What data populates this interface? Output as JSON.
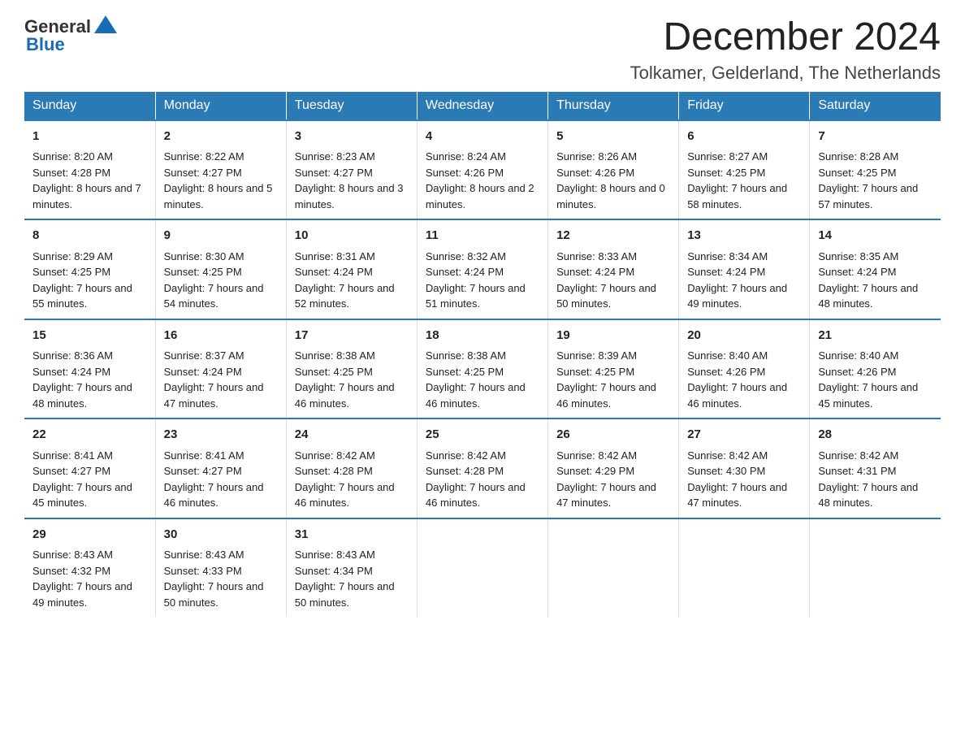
{
  "header": {
    "logo_general": "General",
    "logo_blue": "Blue",
    "month_title": "December 2024",
    "location": "Tolkamer, Gelderland, The Netherlands"
  },
  "days_of_week": [
    "Sunday",
    "Monday",
    "Tuesday",
    "Wednesday",
    "Thursday",
    "Friday",
    "Saturday"
  ],
  "weeks": [
    [
      {
        "num": "1",
        "sunrise": "8:20 AM",
        "sunset": "4:28 PM",
        "daylight": "8 hours and 7 minutes."
      },
      {
        "num": "2",
        "sunrise": "8:22 AM",
        "sunset": "4:27 PM",
        "daylight": "8 hours and 5 minutes."
      },
      {
        "num": "3",
        "sunrise": "8:23 AM",
        "sunset": "4:27 PM",
        "daylight": "8 hours and 3 minutes."
      },
      {
        "num": "4",
        "sunrise": "8:24 AM",
        "sunset": "4:26 PM",
        "daylight": "8 hours and 2 minutes."
      },
      {
        "num": "5",
        "sunrise": "8:26 AM",
        "sunset": "4:26 PM",
        "daylight": "8 hours and 0 minutes."
      },
      {
        "num": "6",
        "sunrise": "8:27 AM",
        "sunset": "4:25 PM",
        "daylight": "7 hours and 58 minutes."
      },
      {
        "num": "7",
        "sunrise": "8:28 AM",
        "sunset": "4:25 PM",
        "daylight": "7 hours and 57 minutes."
      }
    ],
    [
      {
        "num": "8",
        "sunrise": "8:29 AM",
        "sunset": "4:25 PM",
        "daylight": "7 hours and 55 minutes."
      },
      {
        "num": "9",
        "sunrise": "8:30 AM",
        "sunset": "4:25 PM",
        "daylight": "7 hours and 54 minutes."
      },
      {
        "num": "10",
        "sunrise": "8:31 AM",
        "sunset": "4:24 PM",
        "daylight": "7 hours and 52 minutes."
      },
      {
        "num": "11",
        "sunrise": "8:32 AM",
        "sunset": "4:24 PM",
        "daylight": "7 hours and 51 minutes."
      },
      {
        "num": "12",
        "sunrise": "8:33 AM",
        "sunset": "4:24 PM",
        "daylight": "7 hours and 50 minutes."
      },
      {
        "num": "13",
        "sunrise": "8:34 AM",
        "sunset": "4:24 PM",
        "daylight": "7 hours and 49 minutes."
      },
      {
        "num": "14",
        "sunrise": "8:35 AM",
        "sunset": "4:24 PM",
        "daylight": "7 hours and 48 minutes."
      }
    ],
    [
      {
        "num": "15",
        "sunrise": "8:36 AM",
        "sunset": "4:24 PM",
        "daylight": "7 hours and 48 minutes."
      },
      {
        "num": "16",
        "sunrise": "8:37 AM",
        "sunset": "4:24 PM",
        "daylight": "7 hours and 47 minutes."
      },
      {
        "num": "17",
        "sunrise": "8:38 AM",
        "sunset": "4:25 PM",
        "daylight": "7 hours and 46 minutes."
      },
      {
        "num": "18",
        "sunrise": "8:38 AM",
        "sunset": "4:25 PM",
        "daylight": "7 hours and 46 minutes."
      },
      {
        "num": "19",
        "sunrise": "8:39 AM",
        "sunset": "4:25 PM",
        "daylight": "7 hours and 46 minutes."
      },
      {
        "num": "20",
        "sunrise": "8:40 AM",
        "sunset": "4:26 PM",
        "daylight": "7 hours and 46 minutes."
      },
      {
        "num": "21",
        "sunrise": "8:40 AM",
        "sunset": "4:26 PM",
        "daylight": "7 hours and 45 minutes."
      }
    ],
    [
      {
        "num": "22",
        "sunrise": "8:41 AM",
        "sunset": "4:27 PM",
        "daylight": "7 hours and 45 minutes."
      },
      {
        "num": "23",
        "sunrise": "8:41 AM",
        "sunset": "4:27 PM",
        "daylight": "7 hours and 46 minutes."
      },
      {
        "num": "24",
        "sunrise": "8:42 AM",
        "sunset": "4:28 PM",
        "daylight": "7 hours and 46 minutes."
      },
      {
        "num": "25",
        "sunrise": "8:42 AM",
        "sunset": "4:28 PM",
        "daylight": "7 hours and 46 minutes."
      },
      {
        "num": "26",
        "sunrise": "8:42 AM",
        "sunset": "4:29 PM",
        "daylight": "7 hours and 47 minutes."
      },
      {
        "num": "27",
        "sunrise": "8:42 AM",
        "sunset": "4:30 PM",
        "daylight": "7 hours and 47 minutes."
      },
      {
        "num": "28",
        "sunrise": "8:42 AM",
        "sunset": "4:31 PM",
        "daylight": "7 hours and 48 minutes."
      }
    ],
    [
      {
        "num": "29",
        "sunrise": "8:43 AM",
        "sunset": "4:32 PM",
        "daylight": "7 hours and 49 minutes."
      },
      {
        "num": "30",
        "sunrise": "8:43 AM",
        "sunset": "4:33 PM",
        "daylight": "7 hours and 50 minutes."
      },
      {
        "num": "31",
        "sunrise": "8:43 AM",
        "sunset": "4:34 PM",
        "daylight": "7 hours and 50 minutes."
      },
      null,
      null,
      null,
      null
    ]
  ],
  "labels": {
    "sunrise": "Sunrise:",
    "sunset": "Sunset:",
    "daylight": "Daylight:"
  }
}
